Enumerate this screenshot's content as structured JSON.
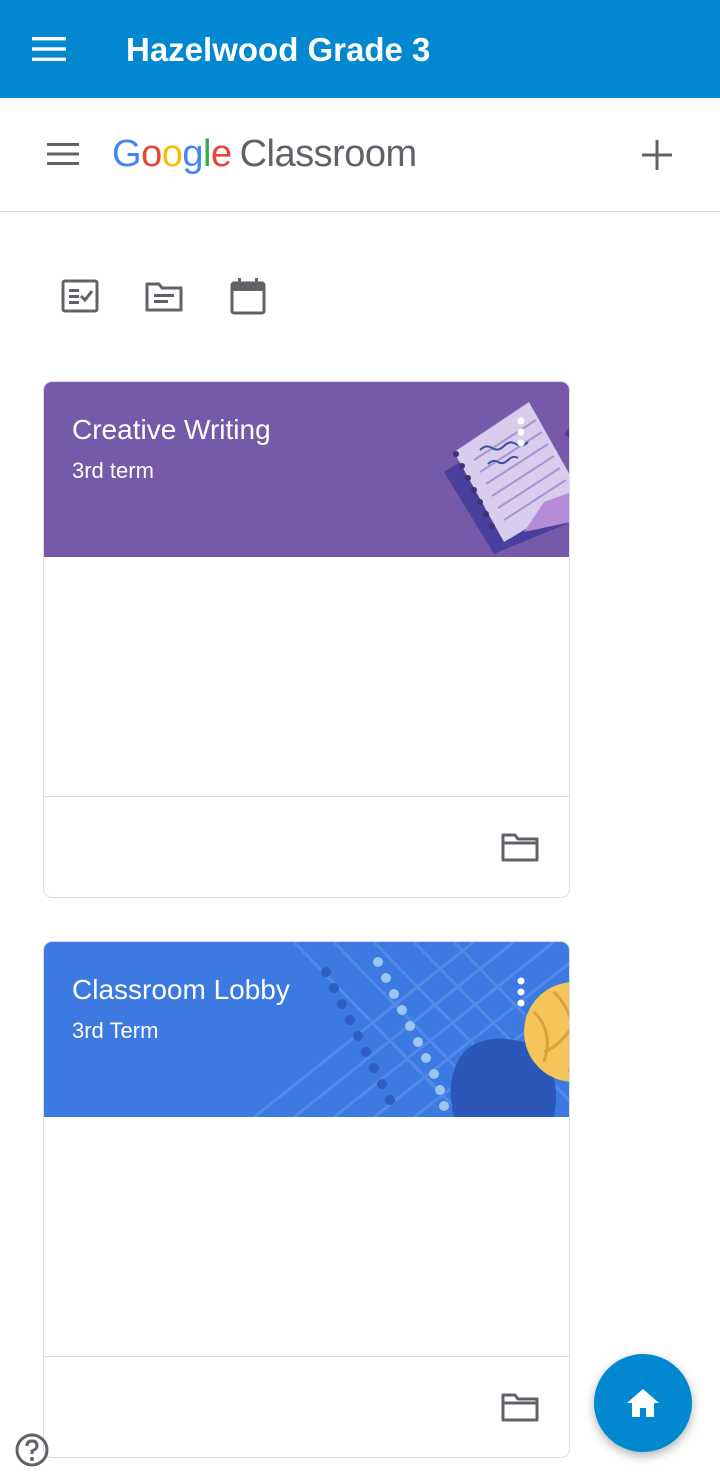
{
  "app_bar": {
    "title": "Hazelwood Grade 3",
    "menu_icon": "menu-icon",
    "color": "#0288d1"
  },
  "classroom_header": {
    "logo": {
      "google": [
        "G",
        "o",
        "o",
        "g",
        "l",
        "e"
      ],
      "product": "Classroom"
    },
    "menu_icon": "menu-icon",
    "add_icon": "plus-icon"
  },
  "toolbar": [
    "todo-icon",
    "class-list-icon",
    "calendar-icon"
  ],
  "classes": [
    {
      "name": "Creative Writing",
      "section": "3rd term",
      "banner_color": "#7659a8",
      "theme": "notebook",
      "folder_icon": "folder-icon"
    },
    {
      "name": "Classroom Lobby",
      "section": "3rd Term",
      "banner_color": "#3c79e0",
      "theme": "sports-ball",
      "folder_icon": "folder-icon"
    }
  ],
  "fab": {
    "icon": "home-icon"
  },
  "help": {
    "icon": "help-icon"
  }
}
